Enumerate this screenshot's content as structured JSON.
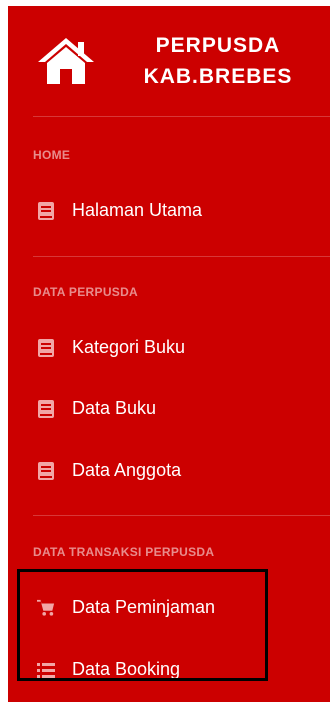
{
  "brand": {
    "line1": "PERPUSDA",
    "line2": "KAB.BREBES",
    "icon": "home-icon"
  },
  "sections": [
    {
      "heading": "HOME",
      "items": [
        {
          "label": "Halaman Utama",
          "icon": "book-icon"
        }
      ]
    },
    {
      "heading": "DATA PERPUSDA",
      "items": [
        {
          "label": "Kategori Buku",
          "icon": "book-icon"
        },
        {
          "label": "Data Buku",
          "icon": "book-icon"
        },
        {
          "label": "Data Anggota",
          "icon": "book-icon"
        }
      ]
    },
    {
      "heading": "DATA TRANSAKSI PERPUSDA",
      "items": [
        {
          "label": "Data Peminjaman",
          "icon": "cart-icon"
        },
        {
          "label": "Data Booking",
          "icon": "list-icon"
        }
      ]
    }
  ],
  "colors": {
    "sidebar_bg": "#cc0000",
    "icon_muted": "#f2a6a6",
    "highlight_border": "#000000"
  }
}
